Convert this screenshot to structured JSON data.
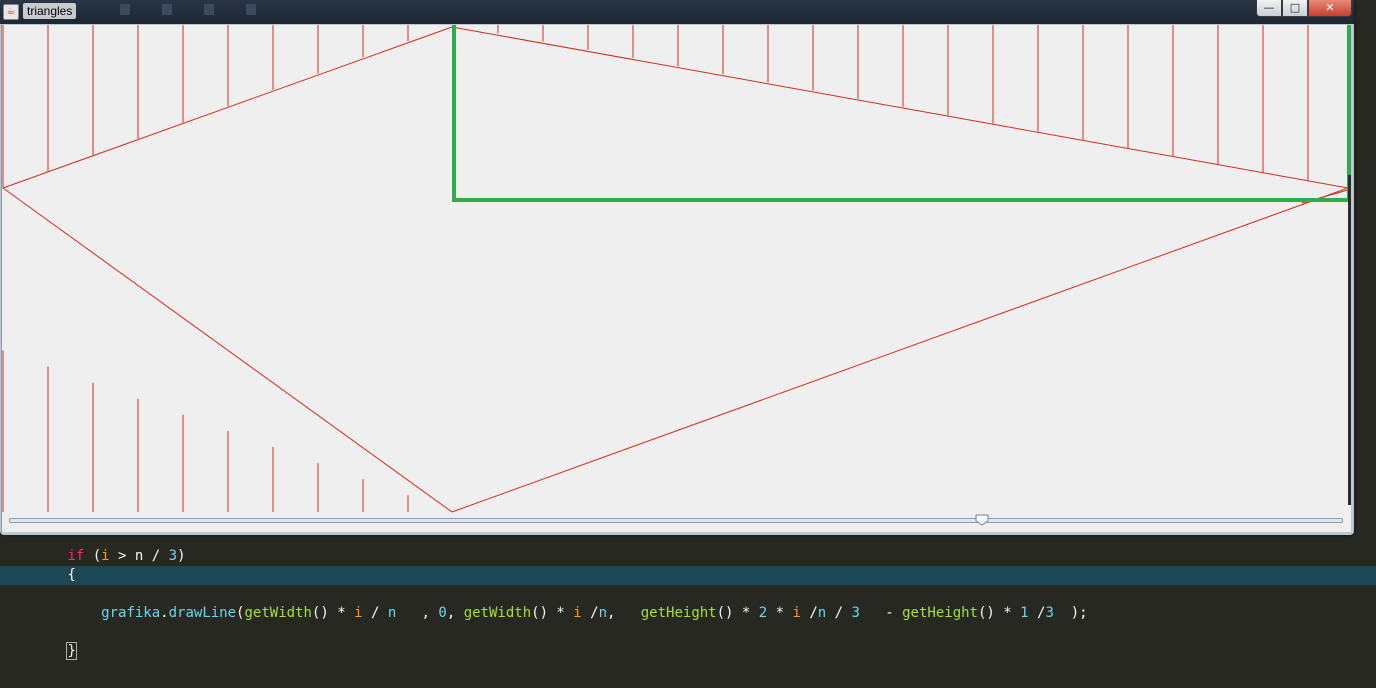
{
  "window": {
    "title": "triangles",
    "app_icon": "java-cup-icon",
    "background_tabs": [
      "",
      "",
      "",
      ""
    ],
    "controls": {
      "minimize": "—",
      "maximize": "□",
      "close": "✕"
    }
  },
  "slider": {
    "value_fraction": 0.73
  },
  "colors": {
    "drawing_lines": "#d52b1e",
    "highlight_box": "#2fad4e",
    "canvas_background": "#efefef",
    "editor_background": "#272822",
    "current_line": "#1c4856"
  },
  "drawing": {
    "n": 30,
    "description_values": {
      "top_hatch_count": 30,
      "bottom_hatch_count": 10
    }
  },
  "code": {
    "line1": {
      "kw": "if",
      "open": " (",
      "var": "i",
      "op": " > ",
      "n": "n",
      "div": " / ",
      "num": "3",
      "close": ")"
    },
    "line2": "{",
    "line3": {
      "obj": "grafika",
      "dot": ".",
      "fn1": "drawLine",
      "p1": "(",
      "fn2": "getWidth",
      "p2": "() * ",
      "v1": "i",
      "p3": " / ",
      "n1": "n",
      "p4": "   , ",
      "z": "0",
      "p5": ", ",
      "fn3": "getWidth",
      "p6": "() * ",
      "v2": "i",
      "p7": " /",
      "n2": "n",
      "p8": ",   ",
      "fn4": "getHeight",
      "p9": "() * ",
      "num2": "2",
      "p10": " * ",
      "v3": "i",
      "p11": " /",
      "n3": "n",
      "p12": " / ",
      "num3": "3",
      "p13": "   - ",
      "fn5": "getHeight",
      "p14": "() * ",
      "num1": "1",
      "p15": " /",
      "num4": "3",
      "p16": "  );"
    },
    "line4": "}"
  }
}
